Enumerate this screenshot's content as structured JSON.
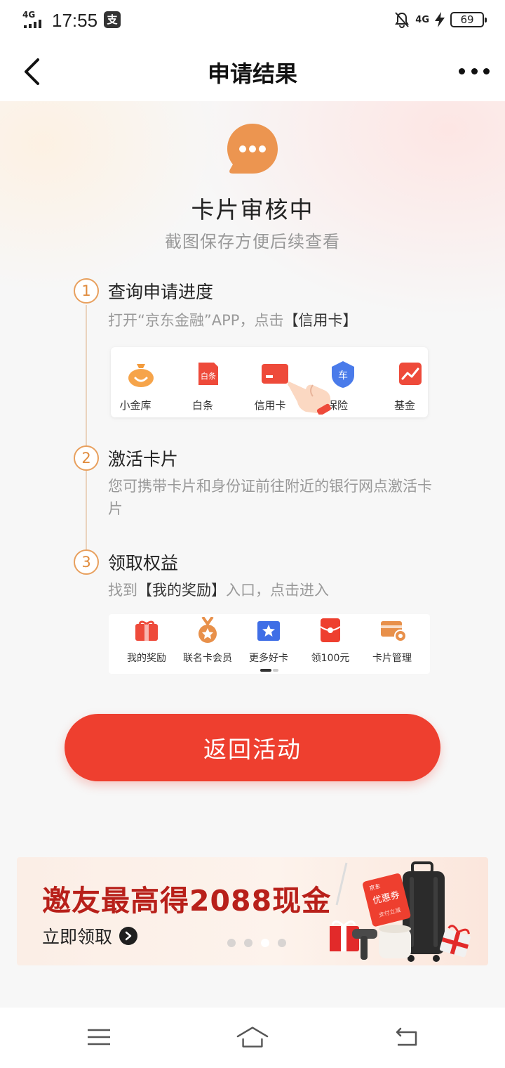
{
  "status_bar": {
    "network": "4G",
    "time": "17:55",
    "app_badge": "支",
    "data_type": "4G",
    "battery": "69"
  },
  "nav": {
    "title": "申请结果"
  },
  "status": {
    "title": "卡片审核中",
    "subtitle": "截图保存方便后续查看"
  },
  "steps": [
    {
      "number": "1",
      "title": "查询申请进度",
      "desc_prefix": "打开“京东金融”APP，点击",
      "desc_highlight": "【信用卡】",
      "desc_suffix": ""
    },
    {
      "number": "2",
      "title": "激活卡片",
      "desc_prefix": "您可携带卡片和身份证前往附近的银行网点激活卡片",
      "desc_highlight": "",
      "desc_suffix": ""
    },
    {
      "number": "3",
      "title": "领取权益",
      "desc_prefix": "找到",
      "desc_highlight": "【我的奖励】",
      "desc_suffix": "入口，点击进入"
    }
  ],
  "jd_app_menu": {
    "items": [
      {
        "label": "小金库",
        "icon": "money-bag-icon"
      },
      {
        "label": "白条",
        "icon": "baitiao-icon",
        "badge": "白条"
      },
      {
        "label": "信用卡",
        "icon": "credit-card-icon"
      },
      {
        "label": "保险",
        "icon": "car-shield-icon",
        "badge": "车"
      },
      {
        "label": "基金",
        "icon": "fund-chart-icon"
      }
    ]
  },
  "card_menu": {
    "items": [
      {
        "label": "我的奖励",
        "icon": "gift-box-icon"
      },
      {
        "label": "联名卡会员",
        "icon": "medal-icon"
      },
      {
        "label": "更多好卡",
        "icon": "star-card-icon"
      },
      {
        "label": "领100元",
        "icon": "red-envelope-icon"
      },
      {
        "label": "卡片管理",
        "icon": "card-settings-icon"
      }
    ]
  },
  "return_button": "返回活动",
  "banner": {
    "title": "邀友最高得2088现金",
    "cta": "立即领取",
    "coupon_brand": "京东",
    "coupon_text": "优惠券",
    "coupon_sub": "支付立减",
    "active_dot": 2,
    "dot_count": 4
  },
  "colors": {
    "accent_red": "#ee3f2f",
    "step_orange": "#e08c3e",
    "chat_icon_orange": "#ec9550",
    "banner_red": "#b8201a"
  }
}
